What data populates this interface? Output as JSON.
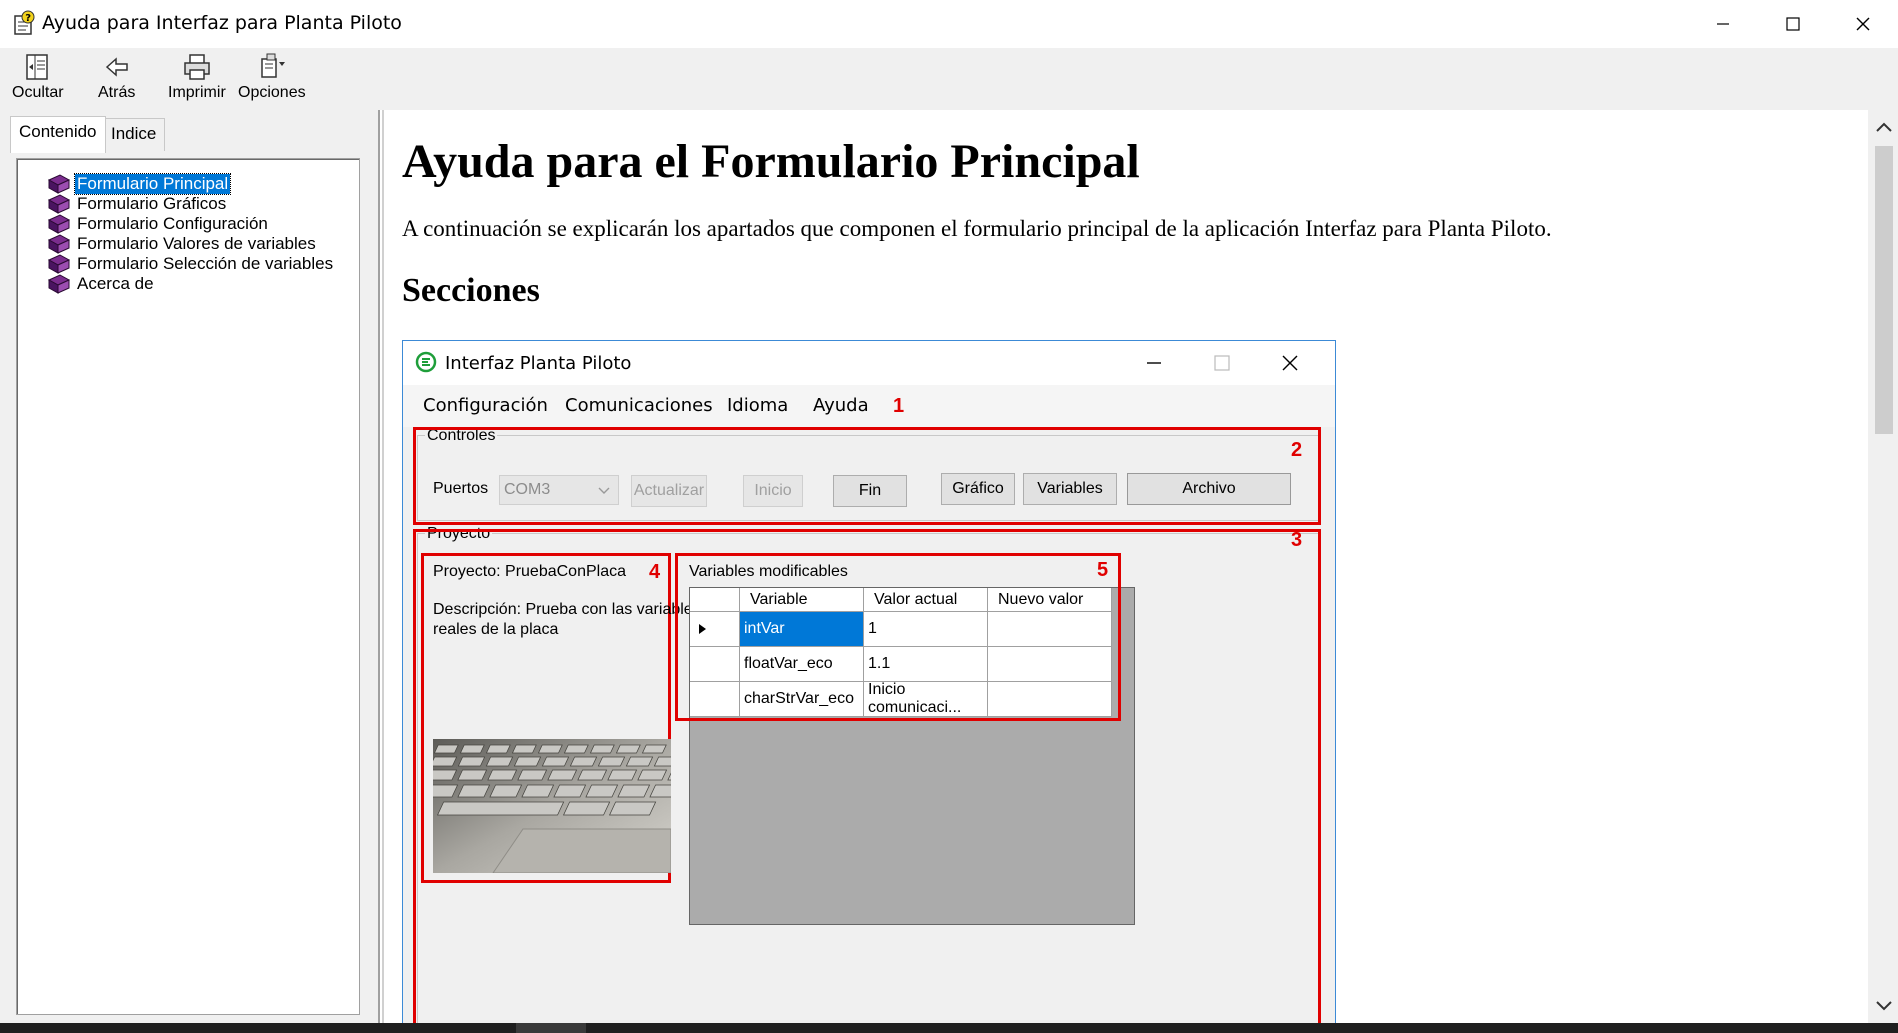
{
  "window": {
    "title": "Ayuda para Interfaz para Planta Piloto"
  },
  "toolbar": {
    "buttons": [
      {
        "label": "Ocultar",
        "icon": "hide-pane-icon"
      },
      {
        "label": "Atrás",
        "icon": "back-arrow-icon"
      },
      {
        "label": "Imprimir",
        "icon": "printer-icon"
      },
      {
        "label": "Opciones",
        "icon": "options-icon"
      }
    ]
  },
  "leftpane": {
    "tabs": [
      {
        "label": "Contenido",
        "active": true
      },
      {
        "label": "Indice",
        "active": false
      }
    ],
    "tree": [
      {
        "label": "Formulario Principal",
        "selected": true
      },
      {
        "label": "Formulario Gráficos",
        "selected": false
      },
      {
        "label": "Formulario Configuración",
        "selected": false
      },
      {
        "label": "Formulario Valores de variables",
        "selected": false
      },
      {
        "label": "Formulario Selección de variables",
        "selected": false
      },
      {
        "label": "Acerca de",
        "selected": false
      }
    ]
  },
  "content": {
    "heading": "Ayuda para el Formulario Principal",
    "intro": "A continuación se explicarán los apartados que componen el formulario principal de la aplicación Interfaz para Planta Piloto.",
    "section_heading": "Secciones"
  },
  "screenshot": {
    "title": "Interfaz Planta Piloto",
    "menu": [
      "Configuración",
      "Comunicaciones",
      "Idioma",
      "Ayuda"
    ],
    "markers": [
      "1",
      "2",
      "3",
      "4",
      "5"
    ],
    "controles": {
      "group_label": "Controles",
      "ports_label": "Puertos",
      "port_value": "COM3",
      "btn_actualizar": "Actualizar",
      "btn_inicio": "Inicio",
      "btn_fin": "Fin",
      "btn_grafico": "Gráfico",
      "btn_variables": "Variables",
      "btn_archivo": "Archivo"
    },
    "proyecto": {
      "group_label": "Proyecto",
      "name": "Proyecto: PruebaConPlaca",
      "description_line1": "Descripción: Prueba con las variables",
      "description_line2": "reales de la placa"
    },
    "variables": {
      "label": "Variables modificables",
      "columns": [
        "Variable",
        "Valor actual",
        "Nuevo valor"
      ],
      "rows": [
        {
          "variable": "intVar",
          "valor": "1",
          "nuevo": "",
          "current": true
        },
        {
          "variable": "floatVar_eco",
          "valor": "1.1",
          "nuevo": "",
          "current": false
        },
        {
          "variable": "charStrVar_eco",
          "valor": "Inicio comunicaci...",
          "nuevo": "",
          "current": false
        }
      ]
    }
  },
  "colors": {
    "accent": "#0078d7",
    "marker_red": "#e00000",
    "book_purple": "#7b2d8e"
  }
}
